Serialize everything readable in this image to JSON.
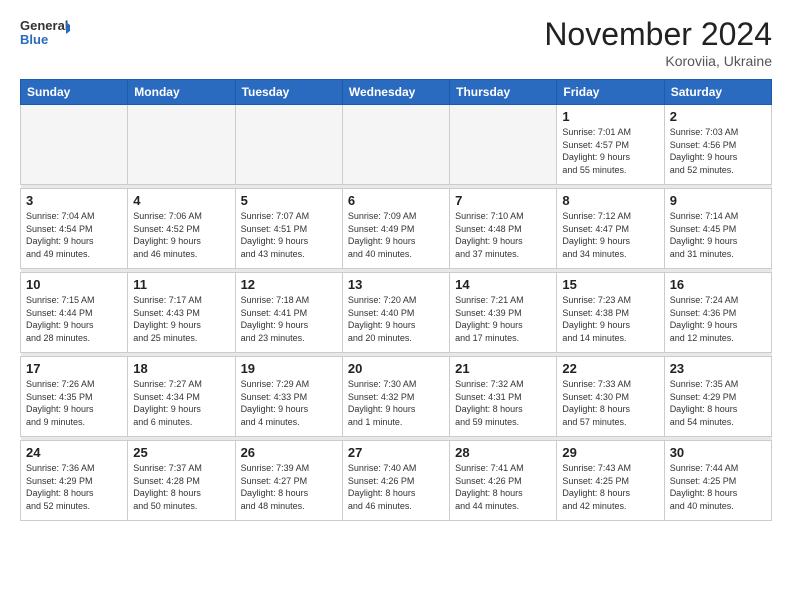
{
  "logo": {
    "line1": "General",
    "line2": "Blue"
  },
  "header": {
    "month": "November 2024",
    "location": "Koroviia, Ukraine"
  },
  "weekdays": [
    "Sunday",
    "Monday",
    "Tuesday",
    "Wednesday",
    "Thursday",
    "Friday",
    "Saturday"
  ],
  "weeks": [
    [
      {
        "day": "",
        "info": ""
      },
      {
        "day": "",
        "info": ""
      },
      {
        "day": "",
        "info": ""
      },
      {
        "day": "",
        "info": ""
      },
      {
        "day": "",
        "info": ""
      },
      {
        "day": "1",
        "info": "Sunrise: 7:01 AM\nSunset: 4:57 PM\nDaylight: 9 hours\nand 55 minutes."
      },
      {
        "day": "2",
        "info": "Sunrise: 7:03 AM\nSunset: 4:56 PM\nDaylight: 9 hours\nand 52 minutes."
      }
    ],
    [
      {
        "day": "3",
        "info": "Sunrise: 7:04 AM\nSunset: 4:54 PM\nDaylight: 9 hours\nand 49 minutes."
      },
      {
        "day": "4",
        "info": "Sunrise: 7:06 AM\nSunset: 4:52 PM\nDaylight: 9 hours\nand 46 minutes."
      },
      {
        "day": "5",
        "info": "Sunrise: 7:07 AM\nSunset: 4:51 PM\nDaylight: 9 hours\nand 43 minutes."
      },
      {
        "day": "6",
        "info": "Sunrise: 7:09 AM\nSunset: 4:49 PM\nDaylight: 9 hours\nand 40 minutes."
      },
      {
        "day": "7",
        "info": "Sunrise: 7:10 AM\nSunset: 4:48 PM\nDaylight: 9 hours\nand 37 minutes."
      },
      {
        "day": "8",
        "info": "Sunrise: 7:12 AM\nSunset: 4:47 PM\nDaylight: 9 hours\nand 34 minutes."
      },
      {
        "day": "9",
        "info": "Sunrise: 7:14 AM\nSunset: 4:45 PM\nDaylight: 9 hours\nand 31 minutes."
      }
    ],
    [
      {
        "day": "10",
        "info": "Sunrise: 7:15 AM\nSunset: 4:44 PM\nDaylight: 9 hours\nand 28 minutes."
      },
      {
        "day": "11",
        "info": "Sunrise: 7:17 AM\nSunset: 4:43 PM\nDaylight: 9 hours\nand 25 minutes."
      },
      {
        "day": "12",
        "info": "Sunrise: 7:18 AM\nSunset: 4:41 PM\nDaylight: 9 hours\nand 23 minutes."
      },
      {
        "day": "13",
        "info": "Sunrise: 7:20 AM\nSunset: 4:40 PM\nDaylight: 9 hours\nand 20 minutes."
      },
      {
        "day": "14",
        "info": "Sunrise: 7:21 AM\nSunset: 4:39 PM\nDaylight: 9 hours\nand 17 minutes."
      },
      {
        "day": "15",
        "info": "Sunrise: 7:23 AM\nSunset: 4:38 PM\nDaylight: 9 hours\nand 14 minutes."
      },
      {
        "day": "16",
        "info": "Sunrise: 7:24 AM\nSunset: 4:36 PM\nDaylight: 9 hours\nand 12 minutes."
      }
    ],
    [
      {
        "day": "17",
        "info": "Sunrise: 7:26 AM\nSunset: 4:35 PM\nDaylight: 9 hours\nand 9 minutes."
      },
      {
        "day": "18",
        "info": "Sunrise: 7:27 AM\nSunset: 4:34 PM\nDaylight: 9 hours\nand 6 minutes."
      },
      {
        "day": "19",
        "info": "Sunrise: 7:29 AM\nSunset: 4:33 PM\nDaylight: 9 hours\nand 4 minutes."
      },
      {
        "day": "20",
        "info": "Sunrise: 7:30 AM\nSunset: 4:32 PM\nDaylight: 9 hours\nand 1 minute."
      },
      {
        "day": "21",
        "info": "Sunrise: 7:32 AM\nSunset: 4:31 PM\nDaylight: 8 hours\nand 59 minutes."
      },
      {
        "day": "22",
        "info": "Sunrise: 7:33 AM\nSunset: 4:30 PM\nDaylight: 8 hours\nand 57 minutes."
      },
      {
        "day": "23",
        "info": "Sunrise: 7:35 AM\nSunset: 4:29 PM\nDaylight: 8 hours\nand 54 minutes."
      }
    ],
    [
      {
        "day": "24",
        "info": "Sunrise: 7:36 AM\nSunset: 4:29 PM\nDaylight: 8 hours\nand 52 minutes."
      },
      {
        "day": "25",
        "info": "Sunrise: 7:37 AM\nSunset: 4:28 PM\nDaylight: 8 hours\nand 50 minutes."
      },
      {
        "day": "26",
        "info": "Sunrise: 7:39 AM\nSunset: 4:27 PM\nDaylight: 8 hours\nand 48 minutes."
      },
      {
        "day": "27",
        "info": "Sunrise: 7:40 AM\nSunset: 4:26 PM\nDaylight: 8 hours\nand 46 minutes."
      },
      {
        "day": "28",
        "info": "Sunrise: 7:41 AM\nSunset: 4:26 PM\nDaylight: 8 hours\nand 44 minutes."
      },
      {
        "day": "29",
        "info": "Sunrise: 7:43 AM\nSunset: 4:25 PM\nDaylight: 8 hours\nand 42 minutes."
      },
      {
        "day": "30",
        "info": "Sunrise: 7:44 AM\nSunset: 4:25 PM\nDaylight: 8 hours\nand 40 minutes."
      }
    ]
  ]
}
